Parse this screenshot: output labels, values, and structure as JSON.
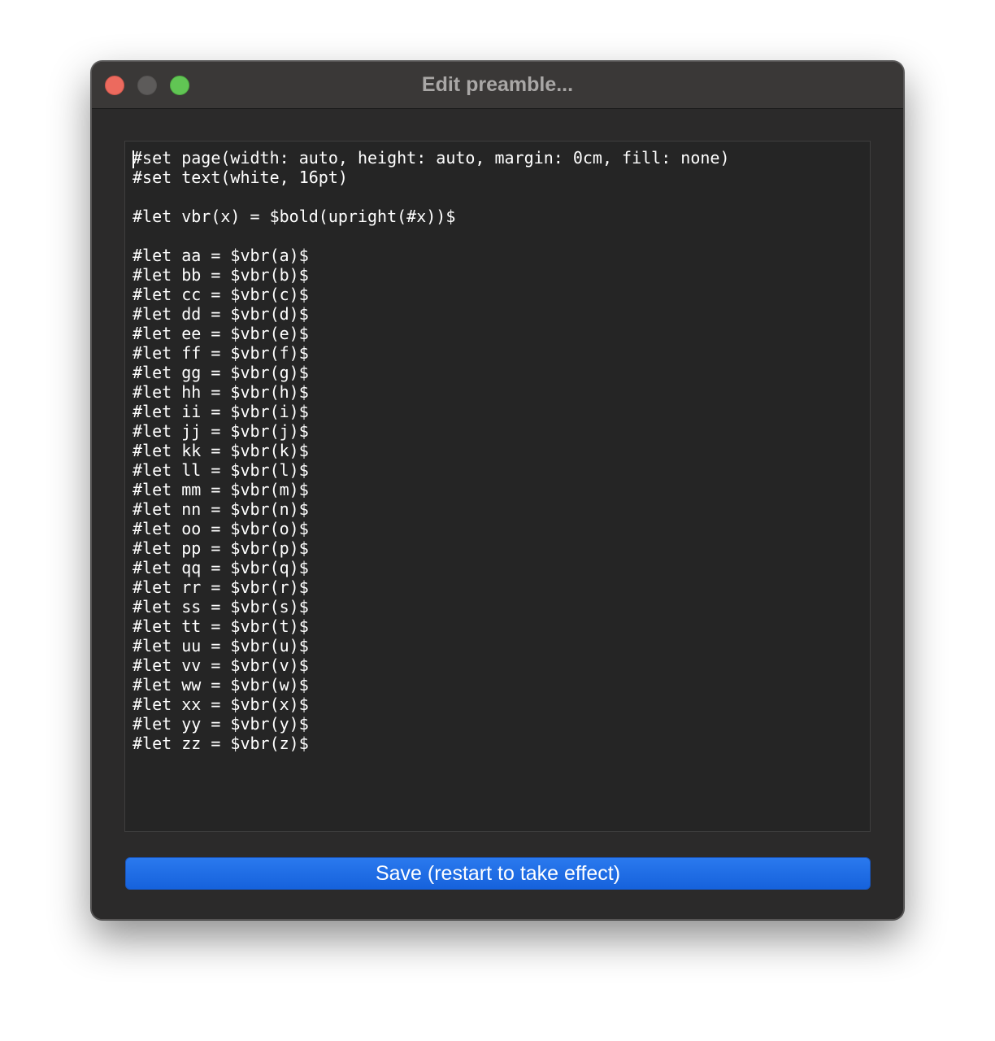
{
  "window": {
    "title": "Edit preamble..."
  },
  "editor": {
    "text": "#set page(width: auto, height: auto, margin: 0cm, fill: none)\n#set text(white, 16pt)\n\n#let vbr(x) = $bold(upright(#x))$\n\n#let aa = $vbr(a)$\n#let bb = $vbr(b)$\n#let cc = $vbr(c)$\n#let dd = $vbr(d)$\n#let ee = $vbr(e)$\n#let ff = $vbr(f)$\n#let gg = $vbr(g)$\n#let hh = $vbr(h)$\n#let ii = $vbr(i)$\n#let jj = $vbr(j)$\n#let kk = $vbr(k)$\n#let ll = $vbr(l)$\n#let mm = $vbr(m)$\n#let nn = $vbr(n)$\n#let oo = $vbr(o)$\n#let pp = $vbr(p)$\n#let qq = $vbr(q)$\n#let rr = $vbr(r)$\n#let ss = $vbr(s)$\n#let tt = $vbr(t)$\n#let uu = $vbr(u)$\n#let vv = $vbr(v)$\n#let ww = $vbr(w)$\n#let xx = $vbr(x)$\n#let yy = $vbr(y)$\n#let zz = $vbr(z)$"
  },
  "actions": {
    "save_label": "Save (restart to take effect)"
  },
  "colors": {
    "accent": "#1a6be3",
    "close": "#ec6a5e",
    "zoom": "#61c554",
    "background": "#2b2a2a",
    "editor_background": "#252525"
  }
}
